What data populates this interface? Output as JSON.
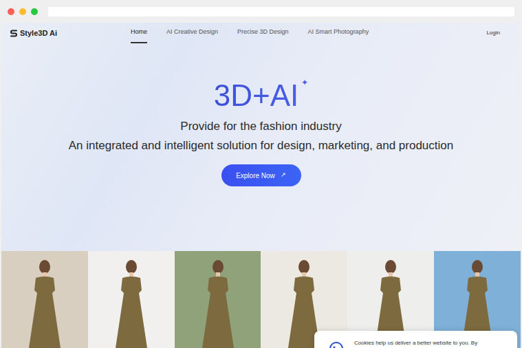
{
  "browser": {
    "dots": [
      {
        "color": "#ff5f57"
      },
      {
        "color": "#febc2e"
      },
      {
        "color": "#28c840"
      }
    ],
    "address": ""
  },
  "nav": {
    "logo": "Style3D Ai",
    "items": [
      {
        "label": "Home",
        "selected": true
      },
      {
        "label": "AI Creative Design",
        "selected": false
      },
      {
        "label": "Precise 3D Design",
        "selected": false
      },
      {
        "label": "AI Smart Photography",
        "selected": false
      }
    ],
    "login": "Login"
  },
  "hero": {
    "title": "3D+AI",
    "sparkle": "✦",
    "lines": [
      "Provide for the fashion industry",
      "An integrated and intelligent solution for design, marketing, and production"
    ],
    "button": {
      "label": "Explore Now",
      "arrow": "↗"
    }
  },
  "photos": [
    {
      "color": "#d9cfc0"
    },
    {
      "color": "#f1f0ee"
    },
    {
      "color": "#8fa27a"
    },
    {
      "color": "#ece8e2"
    },
    {
      "color": "#eeeeec"
    },
    {
      "color": "#7fb0d8"
    }
  ],
  "cookie": {
    "text": "Cookies help us deliver a better website to you. By"
  }
}
